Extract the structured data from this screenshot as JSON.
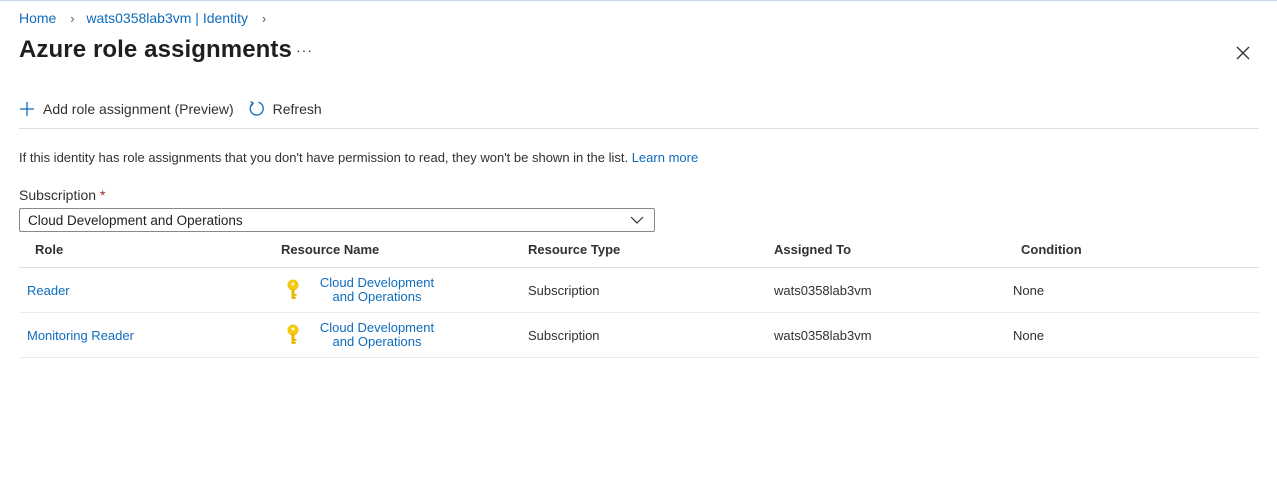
{
  "breadcrumb": {
    "home": "Home",
    "item": "wats0358lab3vm | Identity"
  },
  "page": {
    "title": "Azure role assignments",
    "more": "···"
  },
  "toolbar": {
    "add_label": "Add role assignment (Preview)",
    "refresh_label": "Refresh"
  },
  "info": {
    "text": "If this identity has role assignments that you don't have permission to read, they won't be shown in the list.",
    "link": "Learn more"
  },
  "subscription": {
    "label": "Subscription",
    "required_mark": "*",
    "value": "Cloud Development and Operations"
  },
  "table": {
    "headers": {
      "role": "Role",
      "resource_name": "Resource Name",
      "resource_type": "Resource Type",
      "assigned_to": "Assigned To",
      "condition": "Condition"
    },
    "rows": [
      {
        "role": "Reader",
        "resource_name_1": "Cloud Development",
        "resource_name_2": "and Operations",
        "resource_type": "Subscription",
        "assigned_to": "wats0358lab3vm",
        "condition": "None"
      },
      {
        "role": "Monitoring Reader",
        "resource_name_1": "Cloud Development",
        "resource_name_2": "and Operations",
        "resource_type": "Subscription",
        "assigned_to": "wats0358lab3vm",
        "condition": "None"
      }
    ]
  },
  "colors": {
    "link": "#0f6cbd",
    "key_icon": "#f2c811",
    "required": "#a4262c"
  }
}
